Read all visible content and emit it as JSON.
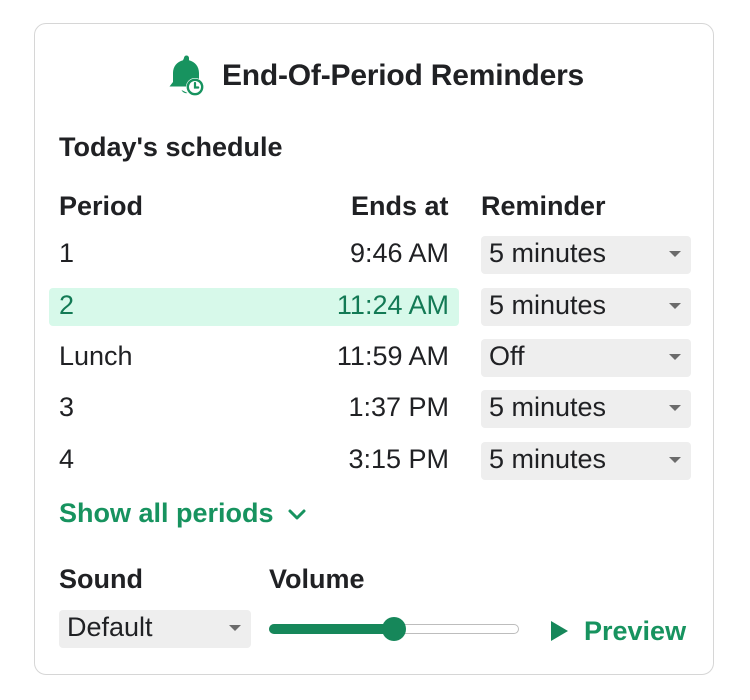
{
  "header": {
    "title": "End-Of-Period Reminders",
    "icon": "bell-clock-icon"
  },
  "schedule": {
    "section_title": "Today's schedule",
    "columns": {
      "period": "Period",
      "ends_at": "Ends at",
      "reminder": "Reminder"
    },
    "rows": [
      {
        "period": "1",
        "ends_at": "9:46 AM",
        "reminder": "5 minutes",
        "current": false
      },
      {
        "period": "2",
        "ends_at": "11:24 AM",
        "reminder": "5 minutes",
        "current": true
      },
      {
        "period": "Lunch",
        "ends_at": "11:59 AM",
        "reminder": "Off",
        "current": false
      },
      {
        "period": "3",
        "ends_at": "1:37 PM",
        "reminder": "5 minutes",
        "current": false
      },
      {
        "period": "4",
        "ends_at": "3:15 PM",
        "reminder": "5 minutes",
        "current": false
      }
    ],
    "show_all_label": "Show all periods"
  },
  "sound": {
    "label": "Sound",
    "selected": "Default"
  },
  "volume": {
    "label": "Volume",
    "level": 0.5
  },
  "preview": {
    "label": "Preview"
  },
  "colors": {
    "accent": "#17935f",
    "highlight_row": "#d7f9ea",
    "highlight_text": "#137a55"
  }
}
